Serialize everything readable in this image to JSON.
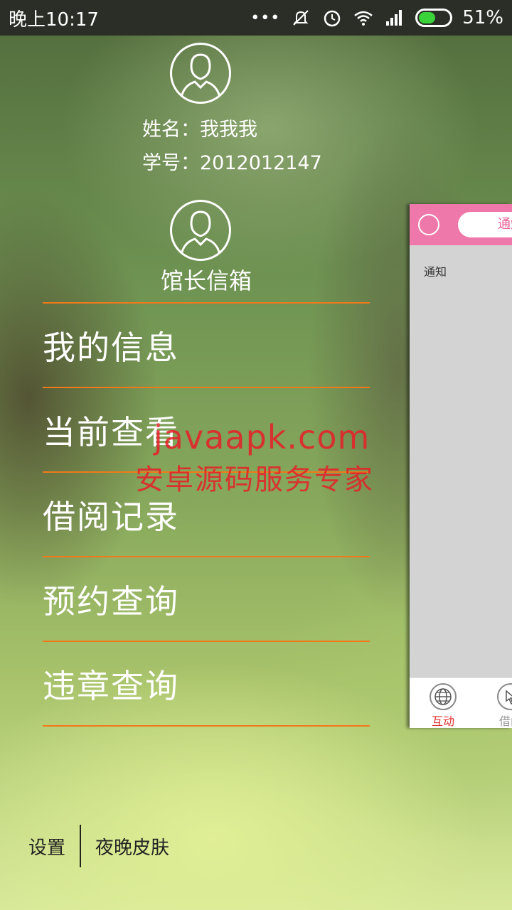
{
  "status_bar": {
    "time": "晚上10:17",
    "dots": "•••",
    "battery_percent": "51%",
    "battery_level": 0.51,
    "icons": [
      "silent-icon",
      "alarm-icon",
      "wifi-icon",
      "signal-icon",
      "battery-icon"
    ]
  },
  "profile": {
    "name_line": "姓名：我我我",
    "id_line": "学号：2012012147"
  },
  "mailbox": {
    "label": "馆长信箱"
  },
  "menu": {
    "items": [
      {
        "label": "我的信息"
      },
      {
        "label": "当前查看"
      },
      {
        "label": "借阅记录"
      },
      {
        "label": "预约查询"
      },
      {
        "label": "违章查询"
      }
    ]
  },
  "footer": {
    "settings": "设置",
    "night_skin": "夜晚皮肤"
  },
  "watermark": {
    "line1": "javaapk.com",
    "line2": "安卓源码服务专家"
  },
  "side_panel": {
    "tab_label": "通知",
    "body_label": "通知",
    "bottom_tabs": [
      {
        "label": "互动",
        "icon": "globe-icon"
      },
      {
        "label": "借阅",
        "icon": "cursor-icon"
      }
    ]
  },
  "colors": {
    "accent_line": "#f07a1a",
    "panel_header": "#ee78aa",
    "active_tab": "#e03030",
    "watermark": "#e61e28"
  }
}
